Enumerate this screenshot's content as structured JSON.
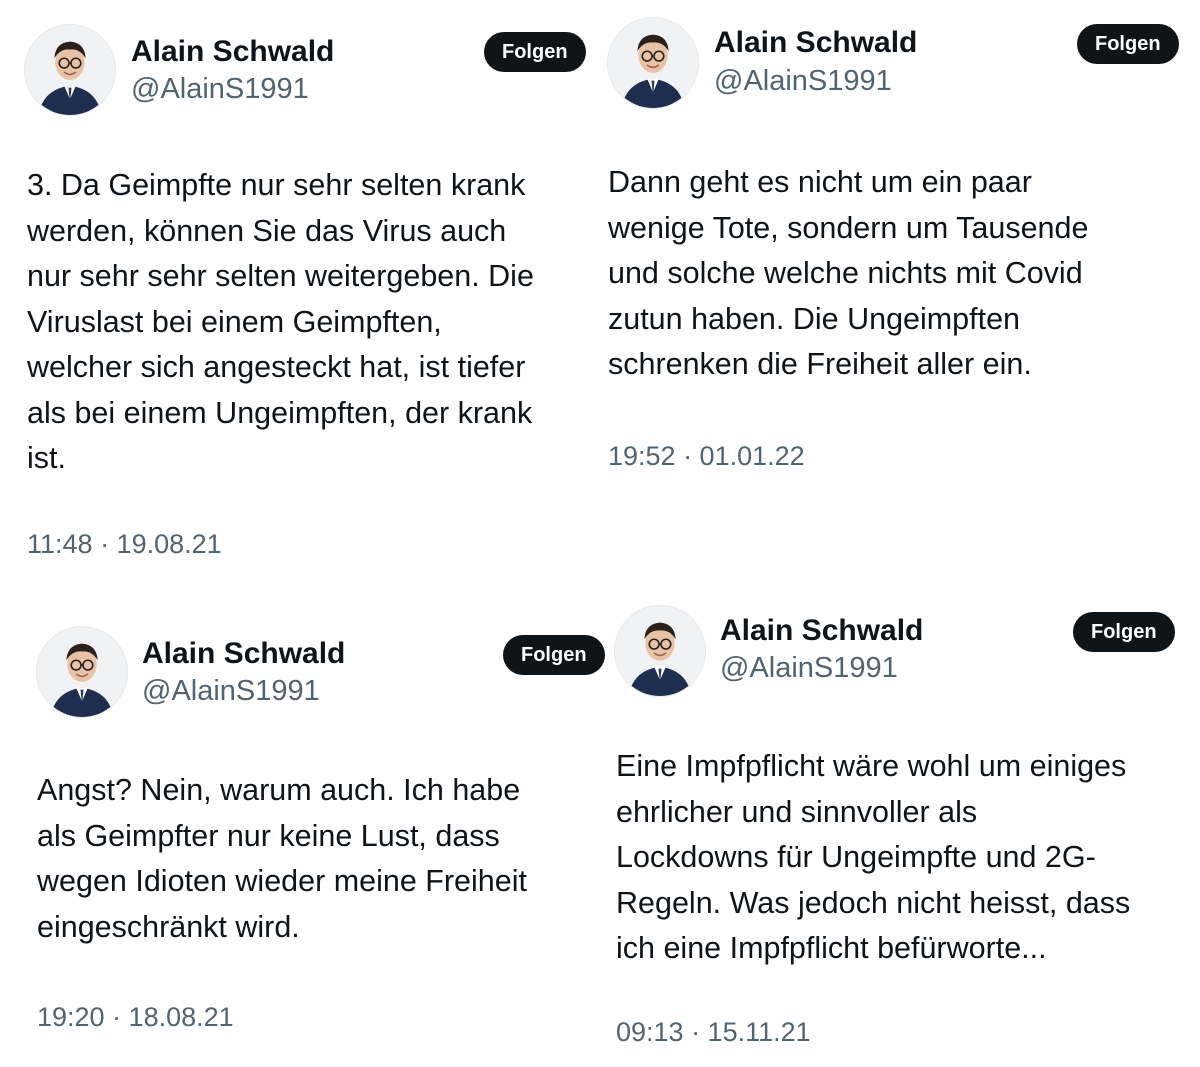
{
  "colors": {
    "text": "#0f1419",
    "secondary": "#536471",
    "button_bg": "#0f1419",
    "button_text": "#ffffff"
  },
  "tweets": [
    {
      "author": {
        "name": "Alain Schwald",
        "handle": "@AlainS1991",
        "avatar_icon": "profile-photo"
      },
      "follow_label": "Folgen",
      "lines": [
        "3. Da Geimpfte nur sehr selten krank",
        "werden, können Sie das Virus auch",
        "nur sehr sehr selten weitergeben. Die",
        "Viruslast bei einem Geimpften,",
        "welcher sich angesteckt hat, ist tiefer",
        "als bei einem Ungeimpften, der krank",
        "ist."
      ],
      "timestamp": "11:48 · 19.08.21"
    },
    {
      "author": {
        "name": "Alain Schwald",
        "handle": "@AlainS1991",
        "avatar_icon": "profile-photo"
      },
      "follow_label": "Folgen",
      "lines": [
        "Dann geht es nicht um ein paar",
        "wenige Tote, sondern um Tausende",
        "und solche welche nichts mit Covid",
        "zutun haben. Die Ungeimpften",
        "schrenken die Freiheit aller ein."
      ],
      "timestamp": "19:52 · 01.01.22"
    },
    {
      "author": {
        "name": "Alain Schwald",
        "handle": "@AlainS1991",
        "avatar_icon": "profile-photo"
      },
      "follow_label": "Folgen",
      "lines": [
        "Angst? Nein, warum auch. Ich habe",
        "als Geimpfter nur keine Lust, dass",
        "wegen Idioten wieder meine Freiheit",
        "eingeschränkt wird."
      ],
      "timestamp": "19:20 · 18.08.21"
    },
    {
      "author": {
        "name": "Alain Schwald",
        "handle": "@AlainS1991",
        "avatar_icon": "profile-photo"
      },
      "follow_label": "Folgen",
      "lines": [
        "Eine Impfpflicht wäre wohl um einiges",
        "ehrlicher und sinnvoller als",
        "Lockdowns für Ungeimpfte und 2G-",
        "Regeln. Was jedoch nicht heisst, dass",
        "ich eine Impfpflicht befürworte..."
      ],
      "timestamp": "09:13 · 15.11.21"
    }
  ]
}
